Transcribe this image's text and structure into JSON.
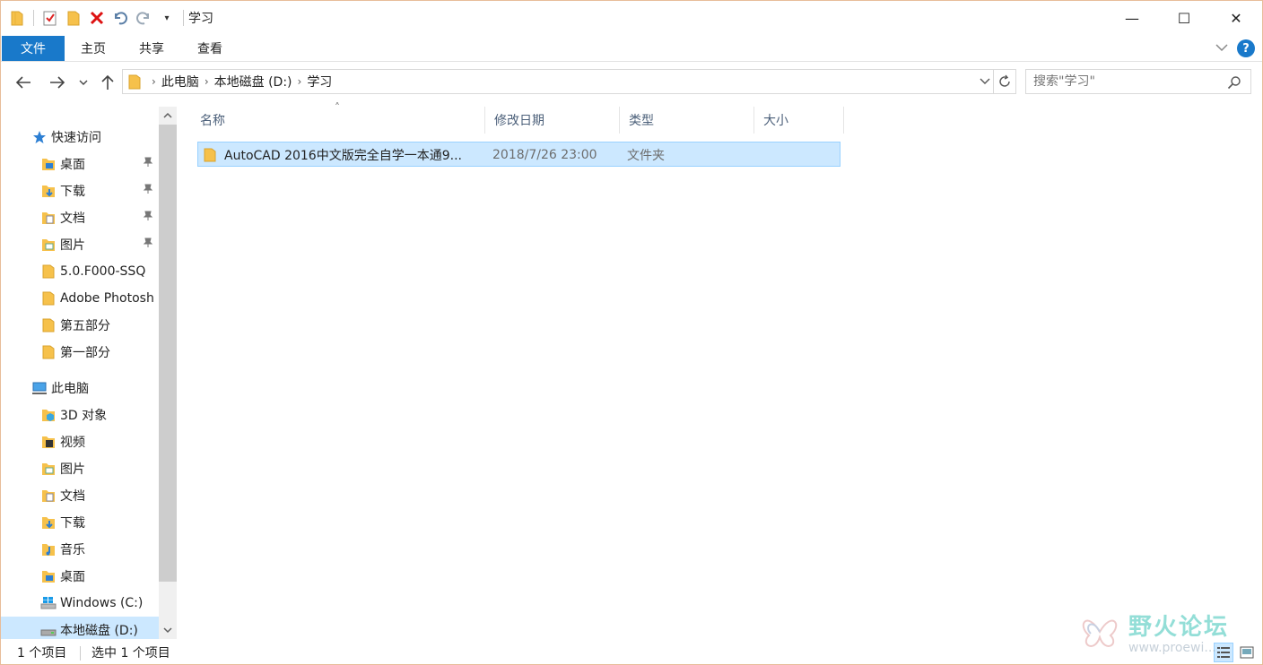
{
  "window": {
    "title": "学习",
    "controls": {
      "minimize": "—",
      "maximize": "☐",
      "close": "✕"
    }
  },
  "quick_access_toolbar": {
    "icons": [
      "folder-icon",
      "properties-icon",
      "new-folder-icon",
      "delete-icon",
      "undo-icon",
      "redo-icon",
      "customize-dropdown-icon"
    ]
  },
  "ribbon": {
    "tabs": [
      "文件",
      "主页",
      "共享",
      "查看"
    ],
    "accent_color": "#1979ca",
    "help_label": "?"
  },
  "address_bar": {
    "crumbs": [
      "此电脑",
      "本地磁盘 (D:)",
      "学习"
    ]
  },
  "search": {
    "placeholder": "搜索\"学习\""
  },
  "nav_pane": {
    "quick_access": {
      "label": "快速访问"
    },
    "quick_items": [
      {
        "label": "桌面",
        "pinned": true,
        "icon": "desktop-folder-icon"
      },
      {
        "label": "下载",
        "pinned": true,
        "icon": "downloads-folder-icon"
      },
      {
        "label": "文档",
        "pinned": true,
        "icon": "documents-folder-icon"
      },
      {
        "label": "图片",
        "pinned": true,
        "icon": "pictures-folder-icon"
      },
      {
        "label": "5.0.F000-SSQ",
        "pinned": false,
        "icon": "folder-icon"
      },
      {
        "label": "Adobe Photosh",
        "pinned": false,
        "icon": "folder-icon"
      },
      {
        "label": "第五部分",
        "pinned": false,
        "icon": "folder-icon"
      },
      {
        "label": "第一部分",
        "pinned": false,
        "icon": "folder-icon"
      }
    ],
    "this_pc": {
      "label": "此电脑"
    },
    "pc_items": [
      {
        "label": "3D 对象",
        "icon": "3d-objects-folder-icon"
      },
      {
        "label": "视频",
        "icon": "videos-folder-icon"
      },
      {
        "label": "图片",
        "icon": "pictures-folder-icon"
      },
      {
        "label": "文档",
        "icon": "documents-folder-icon"
      },
      {
        "label": "下载",
        "icon": "downloads-folder-icon"
      },
      {
        "label": "音乐",
        "icon": "music-folder-icon"
      },
      {
        "label": "桌面",
        "icon": "desktop-folder-icon"
      },
      {
        "label": "Windows (C:)",
        "icon": "windows-drive-icon"
      },
      {
        "label": "本地磁盘 (D:)",
        "icon": "local-disk-icon",
        "selected": true
      }
    ]
  },
  "file_list": {
    "columns": [
      "名称",
      "修改日期",
      "类型",
      "大小"
    ],
    "rows": [
      {
        "name": "AutoCAD 2016中文版完全自学一本通9...",
        "modified": "2018/7/26 23:00",
        "type": "文件夹",
        "size": "",
        "selected": true
      }
    ]
  },
  "status_bar": {
    "item_count": "1 个项目",
    "selected_count": "选中 1 个项目"
  },
  "watermark": {
    "text": "野火论坛",
    "url": "www.proewi..."
  }
}
